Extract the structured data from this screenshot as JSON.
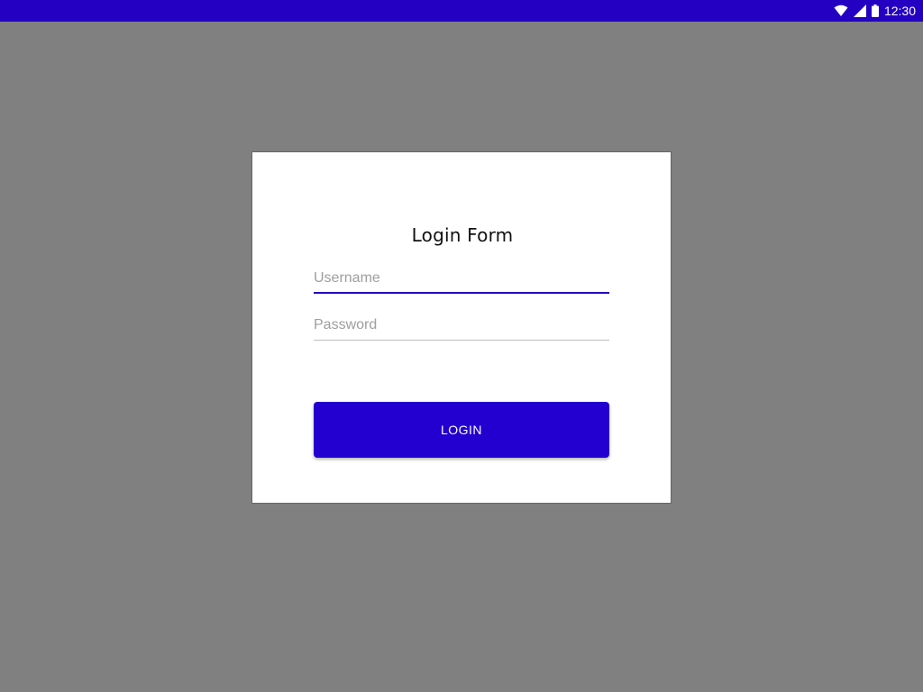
{
  "status_bar": {
    "time": "12:30",
    "icons": [
      "wifi-icon",
      "cellular-signal-icon",
      "battery-icon"
    ],
    "background_color": "#2300c2"
  },
  "login_form": {
    "title": "Login Form",
    "username": {
      "placeholder": "Username",
      "value": ""
    },
    "password": {
      "placeholder": "Password",
      "value": ""
    },
    "login_button_label": "LOGIN",
    "accent_color": "#2300d0"
  }
}
